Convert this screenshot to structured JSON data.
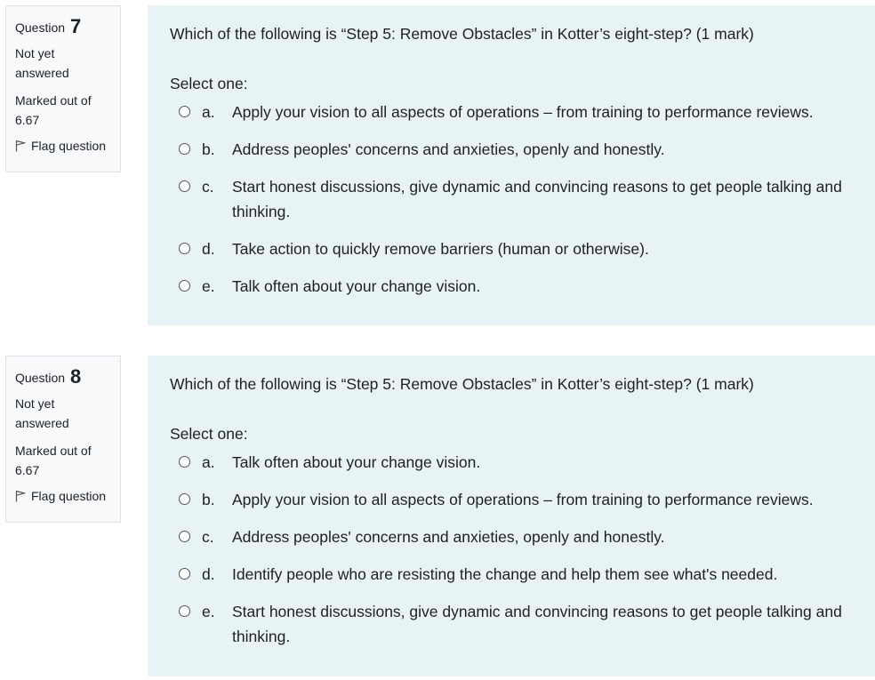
{
  "questions": [
    {
      "label": "Question",
      "number": "7",
      "state": "Not yet answered",
      "grade": "Marked out of 6.67",
      "flag_label": "Flag question",
      "question_text": "Which of the following is “Step 5: Remove Obstacles” in Kotter’s eight-step? (1 mark)",
      "prompt": "Select one:",
      "options": [
        {
          "letter": "a.",
          "text": "Apply your vision to all aspects of operations – from training to performance reviews."
        },
        {
          "letter": "b.",
          "text": "Address peoples' concerns and anxieties, openly and honestly."
        },
        {
          "letter": "c.",
          "text": "Start honest discussions, give dynamic and convincing reasons to get people talking and thinking."
        },
        {
          "letter": "d.",
          "text": "Take action to quickly remove barriers (human or otherwise)."
        },
        {
          "letter": "e.",
          "text": "Talk often about your change vision."
        }
      ]
    },
    {
      "label": "Question",
      "number": "8",
      "state": "Not yet answered",
      "grade": "Marked out of 6.67",
      "flag_label": "Flag question",
      "question_text": "Which of the following is “Step 5: Remove Obstacles” in Kotter’s eight-step? (1 mark)",
      "prompt": "Select one:",
      "options": [
        {
          "letter": "a.",
          "text": "Talk often about your change vision."
        },
        {
          "letter": "b.",
          "text": "Apply your vision to all aspects of operations – from training to performance reviews."
        },
        {
          "letter": "c.",
          "text": "Address peoples' concerns and anxieties, openly and honestly."
        },
        {
          "letter": "d.",
          "text": "Identify people who are resisting the change and help them see what's needed."
        },
        {
          "letter": "e.",
          "text": "Start honest discussions, give dynamic and convincing reasons to get people talking and thinking."
        }
      ]
    }
  ],
  "colors": {
    "content_bg": "#e7f3f5",
    "info_bg": "#f8f9fa",
    "border": "#dee2e6"
  }
}
